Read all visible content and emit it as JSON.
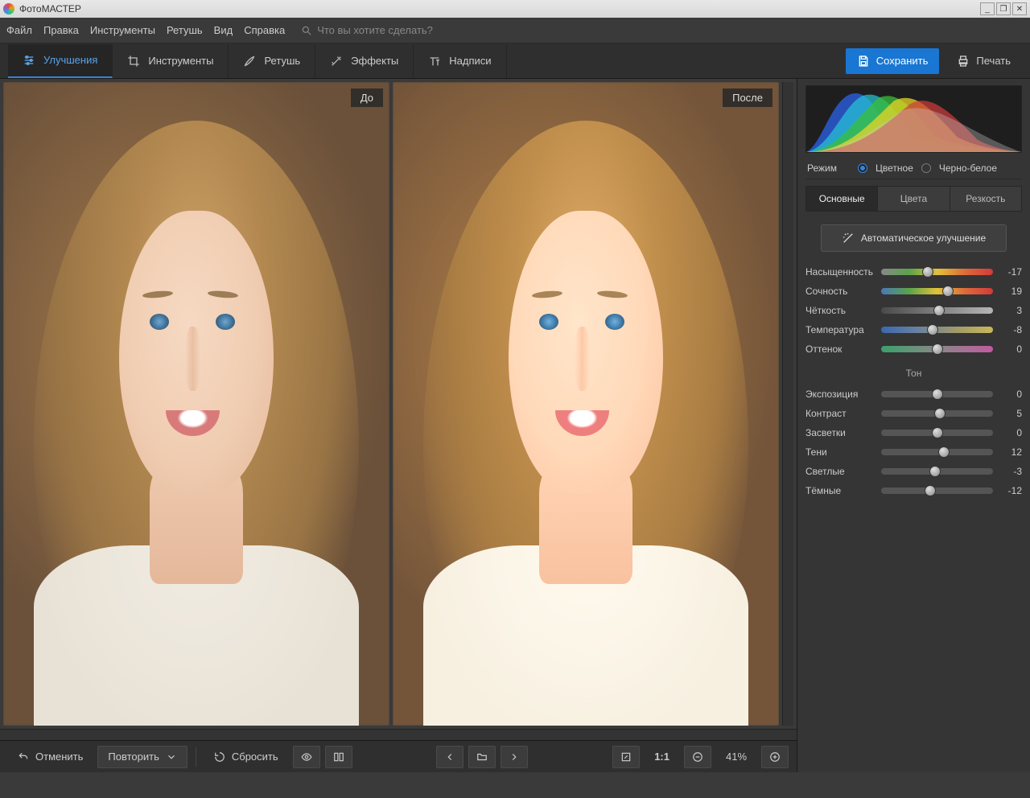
{
  "app": {
    "title": "ФотоМАСТЕР"
  },
  "menu": {
    "items": [
      "Файл",
      "Правка",
      "Инструменты",
      "Ретушь",
      "Вид",
      "Справка"
    ],
    "search_placeholder": "Что вы хотите сделать?"
  },
  "tool_tabs": {
    "items": [
      {
        "id": "enhance",
        "label": "Улучшения"
      },
      {
        "id": "tools",
        "label": "Инструменты"
      },
      {
        "id": "retouch",
        "label": "Ретушь"
      },
      {
        "id": "effects",
        "label": "Эффекты"
      },
      {
        "id": "text",
        "label": "Надписи"
      }
    ],
    "save": "Сохранить",
    "print": "Печать"
  },
  "canvas": {
    "before_label": "До",
    "after_label": "После"
  },
  "panel": {
    "mode_label": "Режим",
    "mode_color": "Цветное",
    "mode_bw": "Черно-белое",
    "subtabs": [
      "Основные",
      "Цвета",
      "Резкость"
    ],
    "auto_enhance": "Автоматическое улучшение",
    "tone_header": "Тон",
    "sliders": {
      "saturation": {
        "label": "Насыщенность",
        "value": -17
      },
      "vibrance": {
        "label": "Сочность",
        "value": 19
      },
      "clarity": {
        "label": "Чёткость",
        "value": 3
      },
      "temperature": {
        "label": "Температура",
        "value": -8
      },
      "tint": {
        "label": "Оттенок",
        "value": 0
      },
      "exposure": {
        "label": "Экспозиция",
        "value": 0
      },
      "contrast": {
        "label": "Контраст",
        "value": 5
      },
      "highlights": {
        "label": "Засветки",
        "value": 0
      },
      "shadows": {
        "label": "Тени",
        "value": 12
      },
      "whites": {
        "label": "Светлые",
        "value": -3
      },
      "blacks": {
        "label": "Тёмные",
        "value": -12
      }
    }
  },
  "status": {
    "undo": "Отменить",
    "redo": "Повторить",
    "reset": "Сбросить",
    "zoom": "41%",
    "one_to_one": "1:1"
  }
}
